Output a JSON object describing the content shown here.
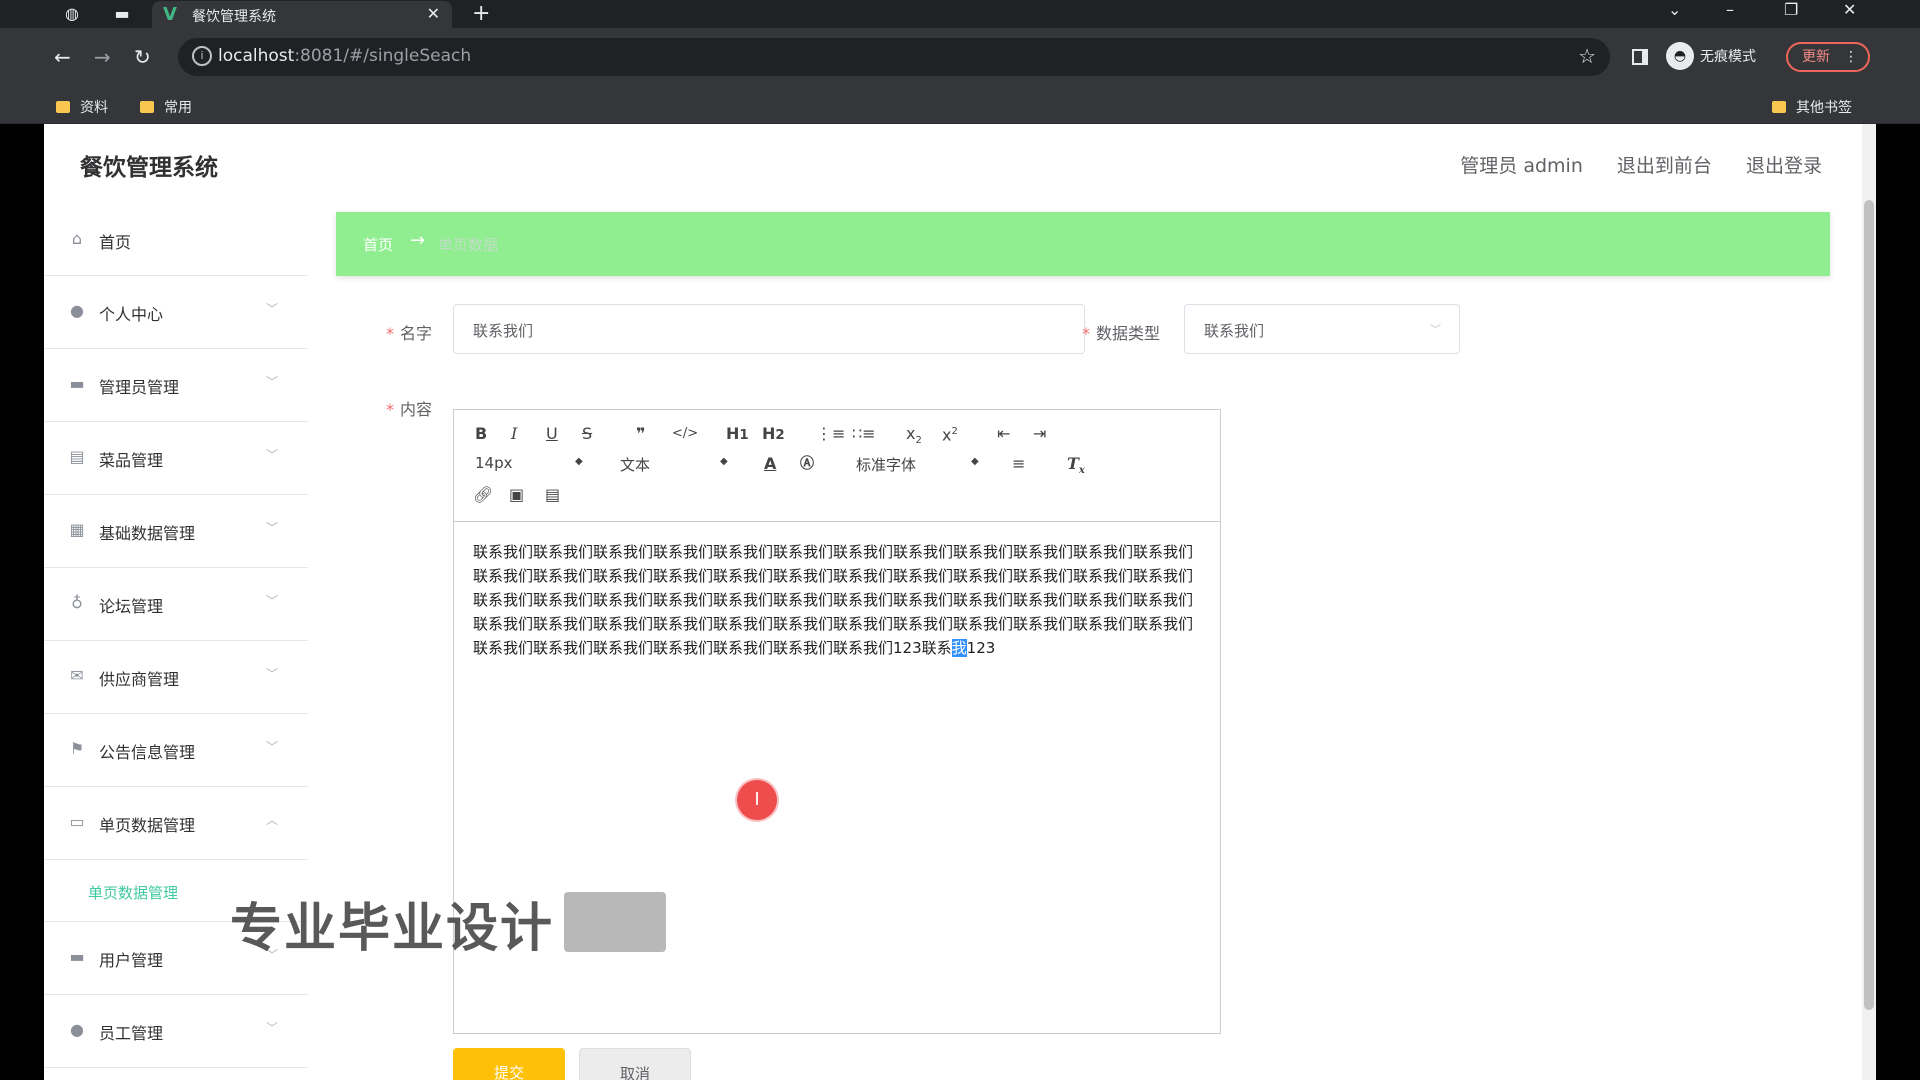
{
  "browser": {
    "tab_title": "餐饮管理系统",
    "url_host": "localhost",
    "url_rest": ":8081/#/singleSeach",
    "incognito_label": "无痕模式",
    "update_label": "更新",
    "bookmarks": [
      "资料",
      "常用"
    ],
    "other_bookmarks": "其他书签"
  },
  "header": {
    "app_title": "餐饮管理系统",
    "admin_label": "管理员 admin",
    "to_front": "退出到前台",
    "logout": "退出登录"
  },
  "sidebar": {
    "items": [
      {
        "label": "首页",
        "icon": "home-icon"
      },
      {
        "label": "个人中心",
        "icon": "user-icon"
      },
      {
        "label": "管理员管理",
        "icon": "admin-icon"
      },
      {
        "label": "菜品管理",
        "icon": "briefcase-icon"
      },
      {
        "label": "基础数据管理",
        "icon": "document-icon"
      },
      {
        "label": "论坛管理",
        "icon": "microphone-icon"
      },
      {
        "label": "供应商管理",
        "icon": "mail-icon"
      },
      {
        "label": "公告信息管理",
        "icon": "flag-icon"
      },
      {
        "label": "单页数据管理",
        "icon": "form-icon"
      },
      {
        "label": "用户管理",
        "icon": "monitor-icon"
      },
      {
        "label": "员工管理",
        "icon": "user-icon"
      }
    ],
    "sub_item": "单页数据管理"
  },
  "breadcrumb": {
    "home": "首页",
    "arrow": "→",
    "current": "单页数据"
  },
  "form": {
    "name_label": "名字",
    "name_value": "联系我们",
    "type_label": "数据类型",
    "type_value": "联系我们",
    "content_label": "内容",
    "required_mark": "*"
  },
  "editor": {
    "font_size": "14px",
    "header_select": "文本",
    "font_family": "标准字体",
    "content_main": "联系我们联系我们联系我们联系我们联系我们联系我们联系我们联系我们联系我们联系我们联系我们联系我们联系我们联系我们联系我们联系我们联系我们联系我们联系我们联系我们联系我们联系我们联系我们联系我们联系我们联系我们联系我们联系我们联系我们联系我们联系我们联系我们联系我们联系我们联系我们联系我们联系我们联系我们联系我们联系我们联系我们联系我们联系我们联系我们联系我们联系我们联系我们联系我们联系我们联系我们联系我们联系我们联系我们联系我们联系我们123联系",
    "content_selected": "我",
    "content_tail": "123"
  },
  "buttons": {
    "submit": "提交",
    "cancel": "取消"
  },
  "watermark": "专业毕业设计"
}
